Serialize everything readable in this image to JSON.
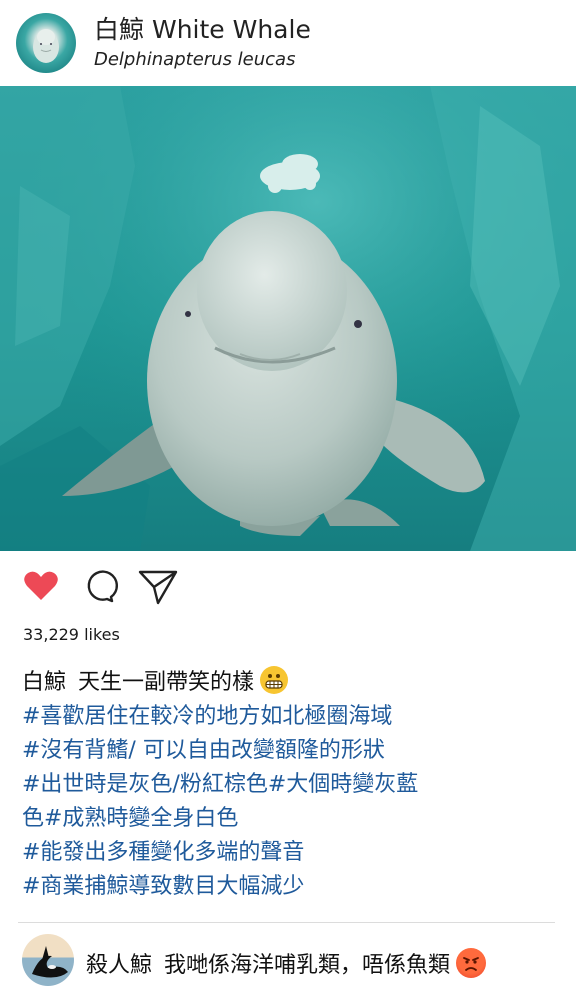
{
  "header": {
    "chinese_name": "白鯨",
    "english_name": "White Whale",
    "scientific_name": "Delphinapterus leucas"
  },
  "post": {
    "likes_text": "33,229 likes",
    "caption_author": "白鯨",
    "caption_text": "天生一副帶笑的樣",
    "caption_emoji": "grimacing-face",
    "hashtag_lines": [
      "#喜歡居住在較冷的地方如北極圈海域",
      "#沒有背鰭/ 可以自由改變額隆的形狀",
      "#出世時是灰色/粉紅棕色#大個時變灰藍",
      "色#成熟時變全身白色",
      "#能發出多種變化多端的聲音",
      "#商業捕鯨導致數目大幅減少"
    ]
  },
  "actions": {
    "like_icon": "heart-icon",
    "comment_icon": "comment-icon",
    "share_icon": "send-icon",
    "like_color": "#ed4956"
  },
  "comment": {
    "author": "殺人鯨",
    "text": "我哋係海洋哺乳類，唔係魚類",
    "emoji": "angry-face"
  },
  "colors": {
    "hashtag": "#1f5a9b",
    "water": "#1f9e9b"
  }
}
